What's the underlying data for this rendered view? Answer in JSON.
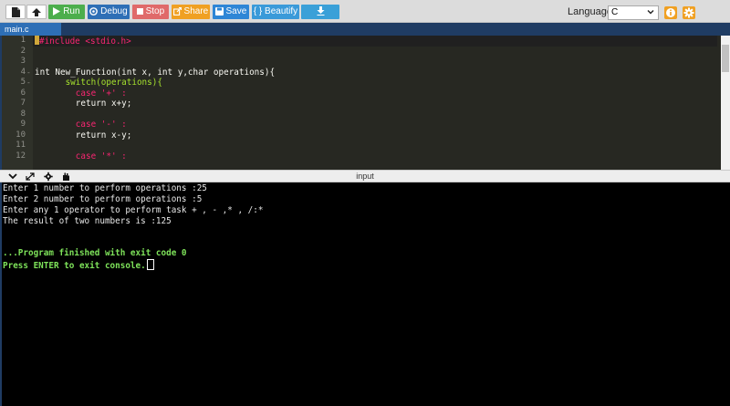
{
  "toolbar": {
    "run_label": "Run",
    "debug_label": "Debug",
    "stop_label": "Stop",
    "share_label": "Share",
    "save_label": "Save",
    "beautify_label": "{ } Beautify",
    "language_label": "Language",
    "language_value": "C",
    "colors": {
      "run": "#4cae4c",
      "debug": "#2e6fb6",
      "stop": "#e06a6a",
      "share": "#f0a022",
      "save": "#2e86d6",
      "beautify": "#3a9ad9",
      "download": "#3aa0d8"
    }
  },
  "file_tab": {
    "label": "main.c"
  },
  "editor": {
    "line_numbers": [
      "1",
      "2",
      "3",
      "4",
      "5",
      "6",
      "7",
      "8",
      "9",
      "10",
      "11",
      "12"
    ],
    "lines": [
      "#include <stdio.h>",
      "",
      "",
      "int New_Function(int x, int y,char operations){",
      "      switch(operations){",
      "        case '+' :",
      "        return x+y;",
      "",
      "        case '-' :",
      "        return x-y;",
      "",
      "        case '*' :"
    ]
  },
  "io": {
    "label": "input"
  },
  "console": {
    "lines": [
      "Enter 1 number to perform operations :25",
      "Enter 2 number to perform operations :5",
      "Enter any 1 operator to perform task + , - ,* , /:*",
      "The result of two numbers is :125"
    ],
    "exit_message": "...Program finished with exit code 0",
    "prompt_message": "Press ENTER to exit console."
  }
}
